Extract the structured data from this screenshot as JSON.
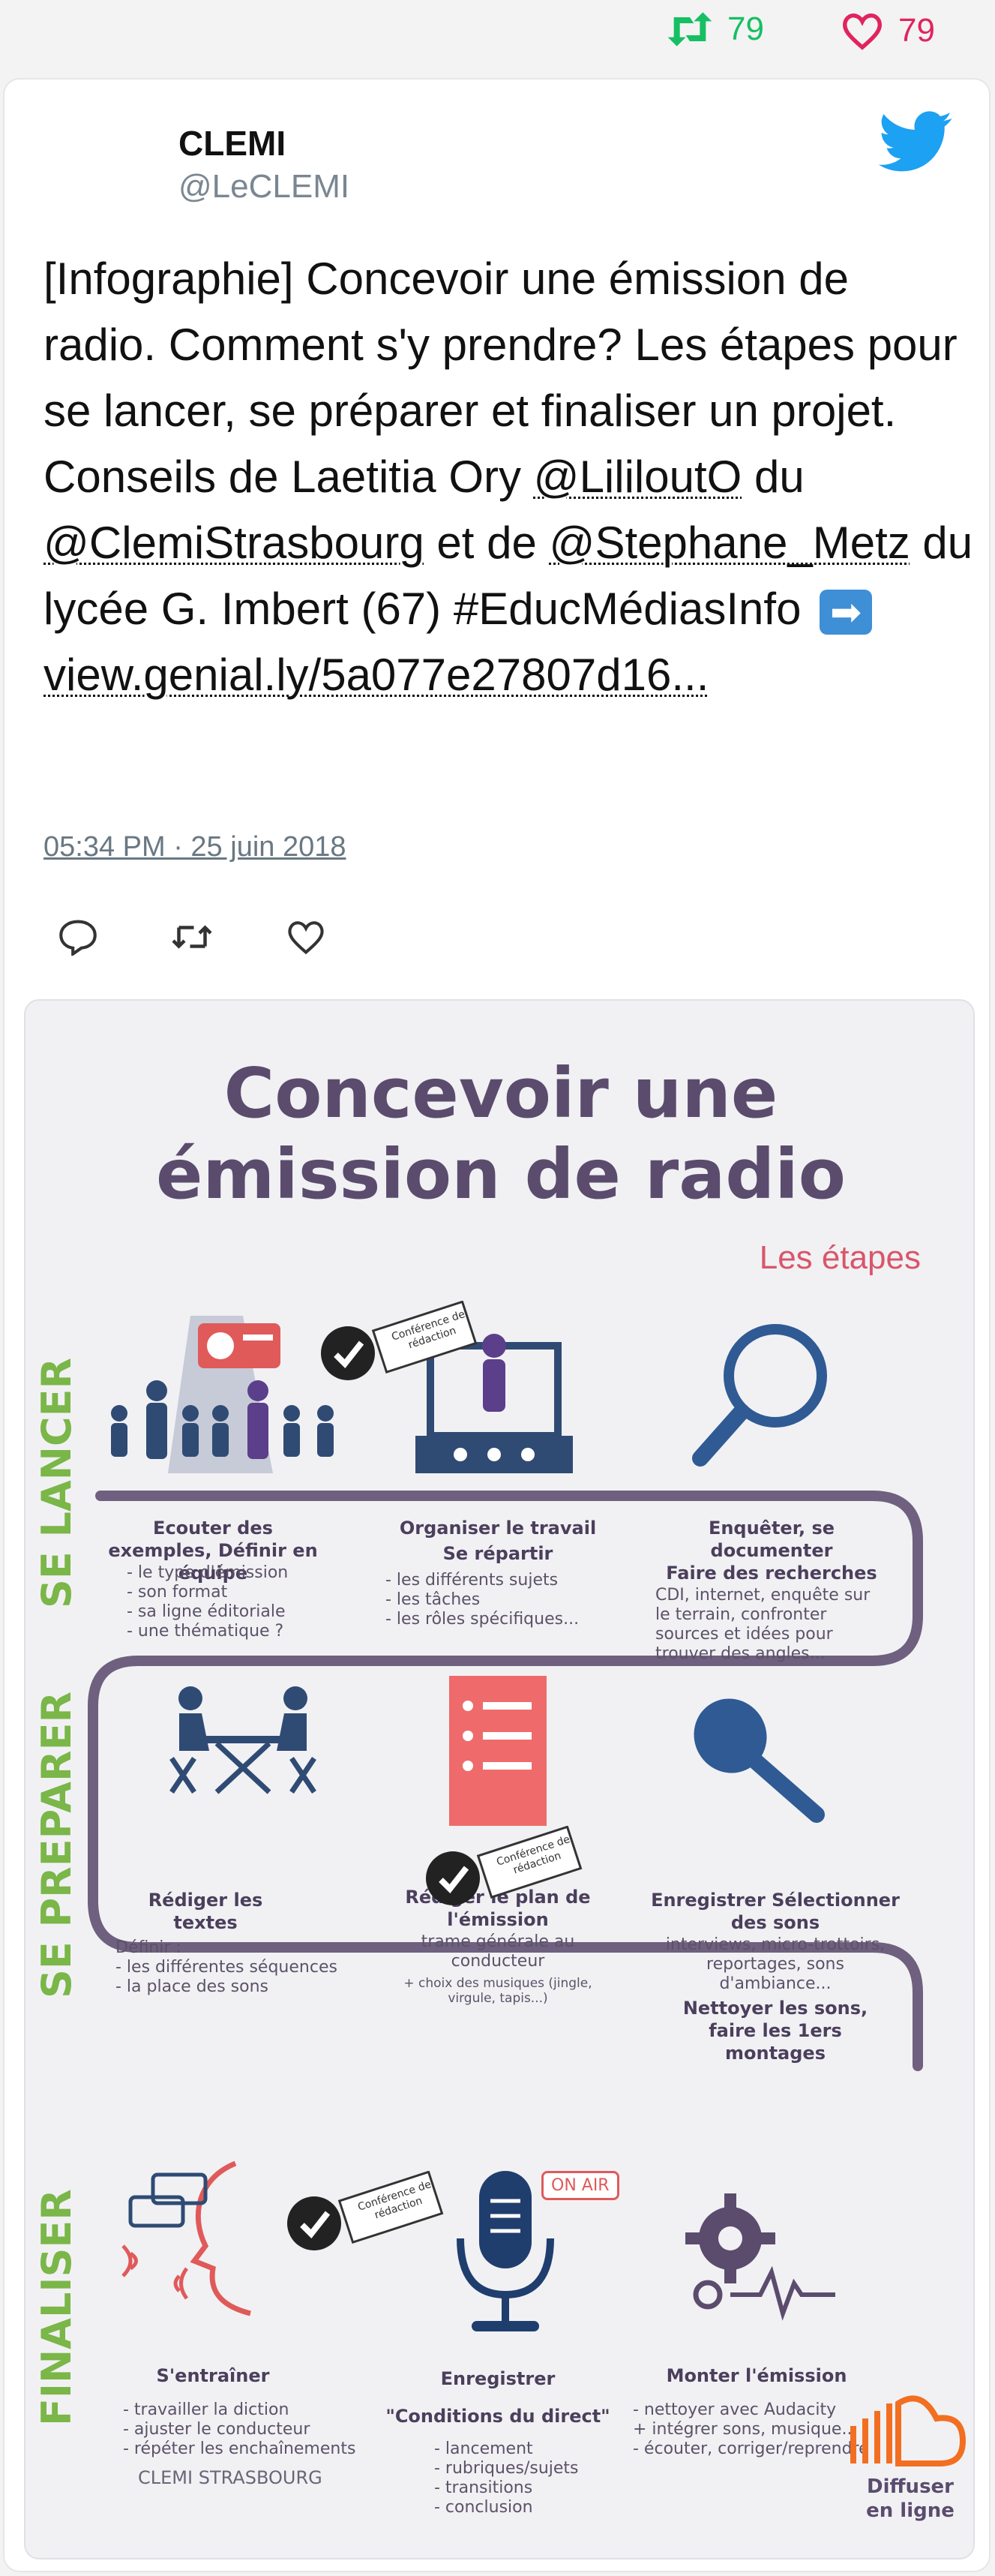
{
  "stats": {
    "retweets": "79",
    "likes": "79"
  },
  "tweet": {
    "author_name": "CLEMI",
    "author_handle": "@LeCLEMI",
    "text_1": "[Infographie] Concevoir une émission de radio. Comment s'y prendre? Les étapes pour se lancer, se préparer et finaliser un projet. Conseils de Laetitia Ory ",
    "mention_1": "@LililoutO",
    "text_2": " du ",
    "mention_2": "@ClemiStrasbourg",
    "text_3": " et de ",
    "mention_3": "@Stephane_Metz",
    "text_4": " du lycée G. Imbert (67) #EducMédiasInfo ",
    "emoji": "➡",
    "link": "view.genial.ly/5a077e27807d16...",
    "timestamp": "05:34 PM · 25 juin 2018"
  },
  "infographic": {
    "title_line1": "Concevoir une",
    "title_line2": "émission de radio",
    "subtitle": "Les étapes",
    "badge": "Conférence de rédaction",
    "onair": "ON AIR",
    "sections": {
      "lancer": "SE LANCER",
      "preparer": "SE PREPARER",
      "finaliser": "FINALISER"
    },
    "steps": {
      "s1_title": "Ecouter des exemples, Définir en équipe",
      "s1_body": "- le type d'émission\n- son format\n- sa ligne éditoriale\n- une thématique ?",
      "s2_title": "Organiser le travail",
      "s2_sub": "Se répartir",
      "s2_body": "- les différents sujets\n- les tâches\n- les rôles spécifiques...",
      "s3_title": "Enquêter, se documenter",
      "s3_sub": "Faire des recherches",
      "s3_body": "CDI, internet, enquête sur le terrain, confronter sources et idées pour trouver des angles...",
      "s4_title": "Rédiger les textes",
      "s4_body": "Définir :\n- les différentes séquences\n- la place des sons",
      "s5_title": "Rédiger le plan de l'émission",
      "s5_body": "trame générale au conducteur",
      "s5_small": "+ choix des musiques (jingle, virgule, tapis...)",
      "s6_title": "Enregistrer Sélectionner des sons",
      "s6_body": "interviews, micro-trottoirs, reportages, sons d'ambiance...",
      "s6_bold": "Nettoyer les sons, faire les 1ers montages",
      "s7_title": "S'entraîner",
      "s7_body": "- travailler la diction\n- ajuster le conducteur\n- répéter les enchaînements",
      "s8_title": "Enregistrer",
      "s8_sub": "\"Conditions du direct\"",
      "s8_body": "- lancement\n- rubriques/sujets\n- transitions\n- conclusion",
      "s9_title": "Monter l'émission",
      "s9_body": "- nettoyer avec Audacity\n+ intégrer sons, musique...\n- écouter, corriger/reprendre"
    },
    "footer_left": "CLEMI STRASBOURG",
    "footer_right": "Diffuser en ligne"
  }
}
